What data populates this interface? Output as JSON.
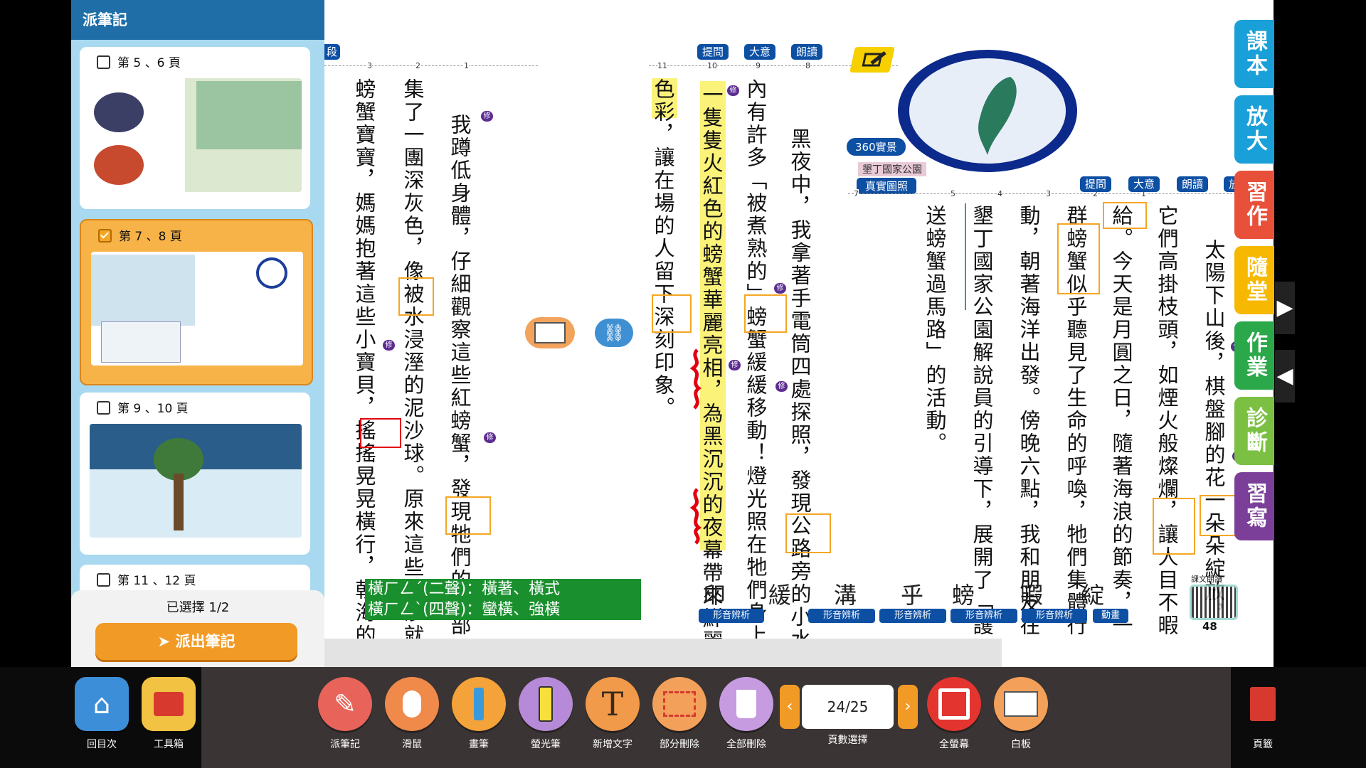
{
  "sidebar": {
    "title": "派筆記",
    "cards": [
      {
        "label": "第 5 、6 頁",
        "checked": false
      },
      {
        "label": "第 7 、8 頁",
        "checked": true
      },
      {
        "label": "第 9 、10 頁",
        "checked": false
      },
      {
        "label": "第 11 、12 頁",
        "checked": false
      }
    ],
    "selected_count": "已選擇 1/2",
    "send_button": "派出筆記"
  },
  "page": {
    "left_columns": [
      "我蹲低身體，仔細觀察這些紅螃蟹，發現牠們的腹部聚",
      "集了一團深灰色，像被水浸溼的泥沙球。原來這些泥沙就是",
      "螃蟹寶寶，媽媽抱著這些小寶貝，搖搖晃晃橫行，朝海的方"
    ],
    "middle_columns": [
      "黑夜中，我拿著手電筒四處探照，發現公路旁的小水溝",
      "內有許多「被煮熟的」螃蟹緩緩移動！燈光照在牠們身上，",
      "一隻隻火紅色的螃蟹華麗亮相，為黑沉沉的夜幕帶來鮮麗的",
      "色彩，讓在場的人留下深刻印象。"
    ],
    "right_columns": [
      "太陽下山後，棋盤腳的花一朵朵綻放，",
      "它們高掛枝頭，如煙火般燦爛，讓人目不暇",
      "給。今天是月圓之日，隨著海浪的節奏，一",
      "群螃蟹似乎聽見了生命的呼喚，牠們集體行",
      "動，朝著海洋出發。傍晚六點，我和朋友在",
      "墾丁國家公園解說員的引導下，展開了「護",
      "送螃蟹過馬路」的活動。"
    ],
    "top_buttons_middle": [
      "提問",
      "大意",
      "朗讀"
    ],
    "top_buttons_right": [
      "提問",
      "大意",
      "朗讀",
      "放大"
    ],
    "ruler_left": [
      "3",
      "2",
      "1"
    ],
    "ruler_middle": [
      "11",
      "10",
      "9",
      "8"
    ],
    "ruler_right": [
      "7",
      "6",
      "5",
      "4",
      "3",
      "2",
      "1"
    ],
    "left_ruler_tag": "段",
    "map_labels": {
      "vr": "360實景",
      "park": "墾丁國家公園",
      "photo": "真實圖照"
    },
    "note_green": [
      "橫ㄏㄥˊ(二聲)：橫著、橫式",
      "橫ㄏㄥˋ(四聲)：蠻橫、強橫"
    ],
    "glyph_words": [
      "印",
      "緩",
      "溝",
      "乎",
      "螃",
      "暇",
      "綻"
    ],
    "glyph_buttons": [
      "形音辨析",
      "形音辨析",
      "形音辨析",
      "形音辨析",
      "形音辨析",
      "動畫"
    ],
    "qr_label": "課文朗讀",
    "page_number": "48"
  },
  "right_tabs": [
    "課本",
    "放大",
    "習作",
    "隨堂",
    "作業",
    "診斷",
    "習寫"
  ],
  "right_tab_colors": [
    "#1aa0d8",
    "#1aa0d8",
    "#e9503a",
    "#f6b800",
    "#2aa84a",
    "#7bc043",
    "#7b3f99"
  ],
  "toolbar": {
    "home": "回目次",
    "toolbox": "工具箱",
    "tools": [
      "派筆記",
      "滑鼠",
      "畫筆",
      "螢光筆",
      "新增文字",
      "部分刪除",
      "全部刪除"
    ],
    "page_value": "24/25",
    "page_label": "頁數選擇",
    "fullscreen": "全螢幕",
    "whiteboard": "白板",
    "bookmark": "頁籤"
  }
}
